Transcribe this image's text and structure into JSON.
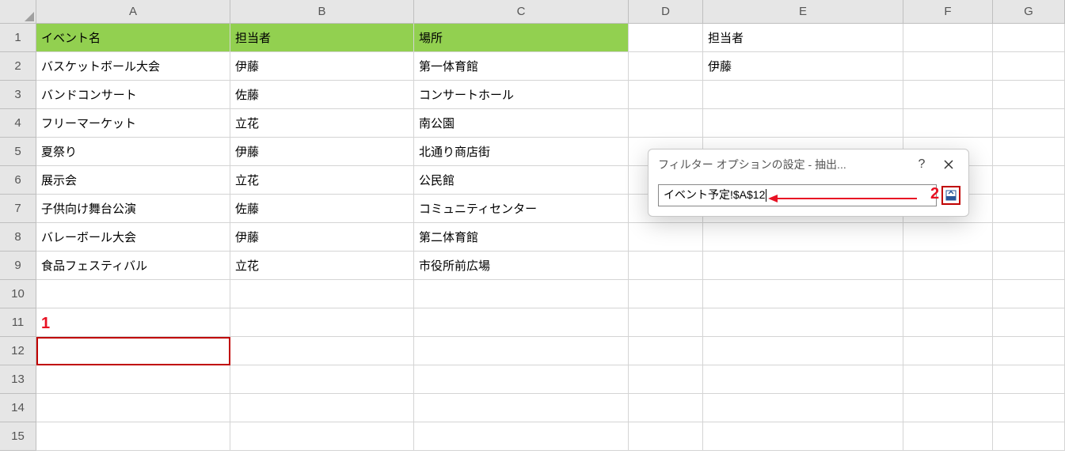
{
  "columns": [
    {
      "label": "A",
      "cls": "wA"
    },
    {
      "label": "B",
      "cls": "wB"
    },
    {
      "label": "C",
      "cls": "wC"
    },
    {
      "label": "D",
      "cls": "wD"
    },
    {
      "label": "E",
      "cls": "wE"
    },
    {
      "label": "F",
      "cls": "wF"
    },
    {
      "label": "G",
      "cls": "wG"
    }
  ],
  "row_count": 15,
  "table": {
    "headers": [
      "イベント名",
      "担当者",
      "場所"
    ],
    "rows": [
      [
        "バスケットボール大会",
        "伊藤",
        "第一体育館"
      ],
      [
        "バンドコンサート",
        "佐藤",
        "コンサートホール"
      ],
      [
        "フリーマーケット",
        "立花",
        "南公園"
      ],
      [
        "夏祭り",
        "伊藤",
        "北通り商店街"
      ],
      [
        "展示会",
        "立花",
        "公民館"
      ],
      [
        "子供向け舞台公演",
        "佐藤",
        "コミュニティセンター"
      ],
      [
        "バレーボール大会",
        "伊藤",
        "第二体育館"
      ],
      [
        "食品フェスティバル",
        "立花",
        "市役所前広場"
      ]
    ]
  },
  "criteria": {
    "header": "担当者",
    "value": "伊藤"
  },
  "dialog": {
    "title": "フィルター オプションの設定 - 抽出...",
    "help": "?",
    "input_value": "イベント予定!$A$12"
  },
  "annotations": {
    "one": "1",
    "two": "2"
  }
}
